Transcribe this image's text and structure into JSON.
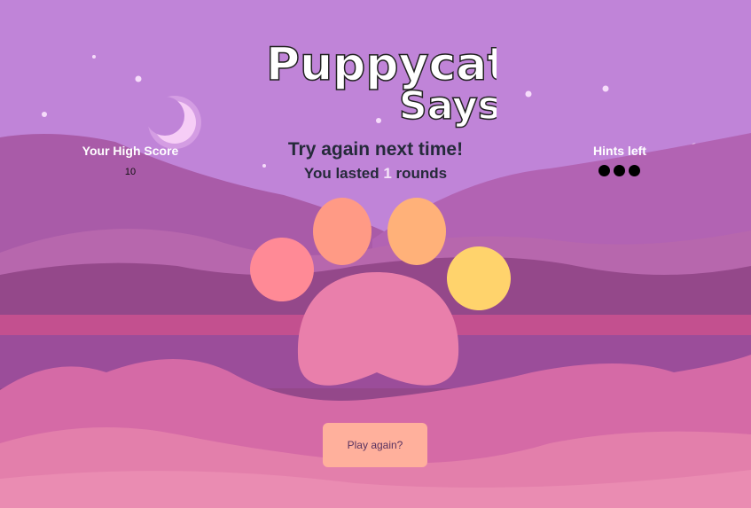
{
  "logo": {
    "line1": "Puppycat",
    "line2": "Says"
  },
  "result": {
    "title": "Try again next time!",
    "prefix": "You lasted",
    "rounds": "1",
    "suffix": "rounds"
  },
  "high_score": {
    "label": "Your High Score",
    "value": "10"
  },
  "hints": {
    "label": "Hints left",
    "remaining": 3
  },
  "play_again_label": "Play again?",
  "colors": {
    "sky": "#c084d8",
    "paw_pad": "#e97fab",
    "toe1": "#ff8a96",
    "toe2": "#ff9a85",
    "toe3": "#ffb179",
    "toe4": "#ffd36c",
    "button": "#ffb09c"
  }
}
